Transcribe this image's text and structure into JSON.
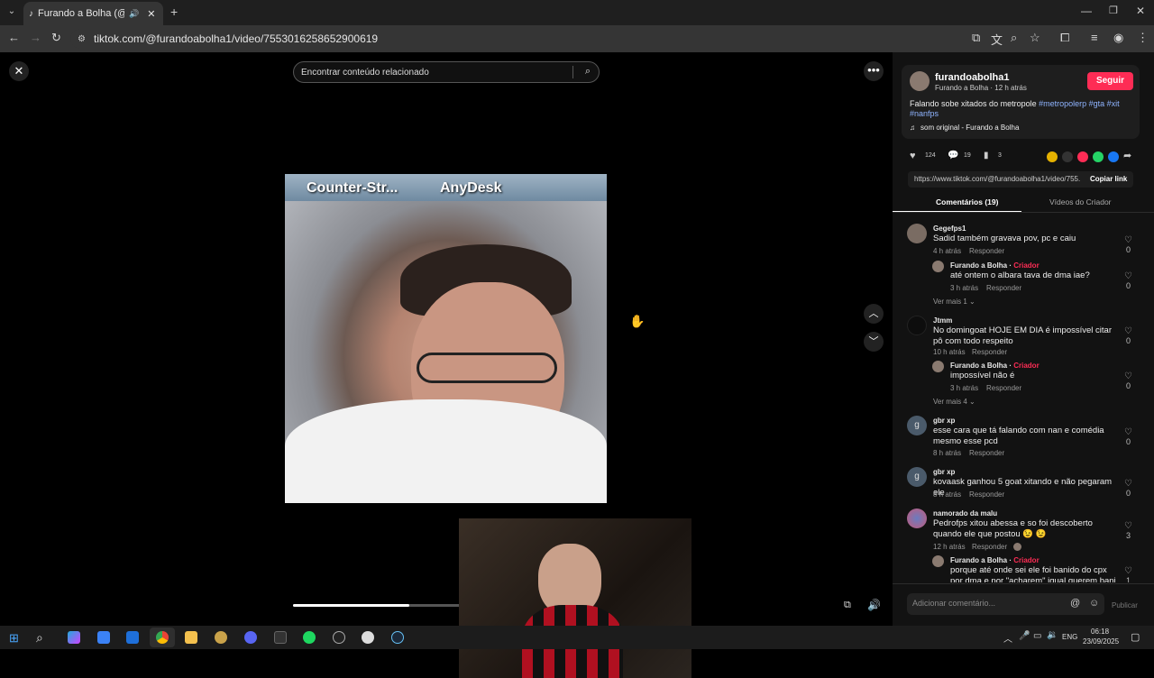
{
  "browser": {
    "tab_title": "Furando a Bolha (@furando",
    "url": "tiktok.com/@furandoabolha1/video/7553016258652900619"
  },
  "search": {
    "placeholder": "Encontrar conteúdo relacionado"
  },
  "video": {
    "overlay_left": "Counter-Str...",
    "overlay_right": "AnyDesk",
    "progress_fraction": 0.38
  },
  "author": {
    "handle": "furandoabolha1",
    "meta": "Furando a Bolha · 12 h atrás",
    "follow_label": "Seguir",
    "caption": "Falando sobe xitados do metropole ",
    "hashtags": "#metropolerp #gta #xit #nanfps",
    "sound": "som original - Furando a Bolha"
  },
  "stats": {
    "likes": "124",
    "comments": "19",
    "saves": "3"
  },
  "share": {
    "link": "https://www.tiktok.com/@furandoabolha1/video/755...",
    "copy_label": "Copiar link"
  },
  "tabs": {
    "comments": "Comentários (19)",
    "creator_videos": "Vídeos do Criador"
  },
  "reply_label": "Responder",
  "creator_label": "Criador",
  "comments": [
    {
      "name": "Gegefps1",
      "text": "Sadid também gravava pov, pc e caiu",
      "time": "4 h atrás",
      "likes": "0"
    },
    {
      "name": "Furando a Bolha",
      "text": "até ontem o albara tava de dma iae?",
      "time": "3 h atrás",
      "likes": "0"
    },
    {
      "name": "Jtmm",
      "text": "No domingoat HOJE EM DIA é impossível citar pô com todo respeito",
      "time": "10 h atrás",
      "likes": "0"
    },
    {
      "name": "Furando a Bolha",
      "text": "impossível não é",
      "time": "3 h atrás",
      "likes": "0"
    },
    {
      "name": "gbr xp",
      "text": "esse cara que tá falando com nan e comédia mesmo esse pcd",
      "time": "8 h atrás",
      "likes": "0"
    },
    {
      "name": "gbr xp",
      "text": "kovaask ganhou 5 goat xitando e não pegaram ele",
      "time": "8 h atrás",
      "likes": "0"
    },
    {
      "name": "namorado da malu",
      "text": "Pedrofps xitou abessa e so foi descoberto quando ele que postou 😉 😉",
      "time": "12 h atrás",
      "likes": "3"
    },
    {
      "name": "Furando a Bolha",
      "text": "porque até onde sei ele foi banido do cpx por dma e por \"acharem\" igual querem bani os",
      "time": "",
      "likes": "1"
    }
  ],
  "more_replies": [
    "Ver mais 1",
    "Ver mais 4"
  ],
  "add_comment": {
    "placeholder": "Adicionar comentário...",
    "publish_label": "Publicar"
  },
  "taskbar": {
    "lang": "ENG",
    "time": "06:18",
    "date": "23/09/2025"
  }
}
